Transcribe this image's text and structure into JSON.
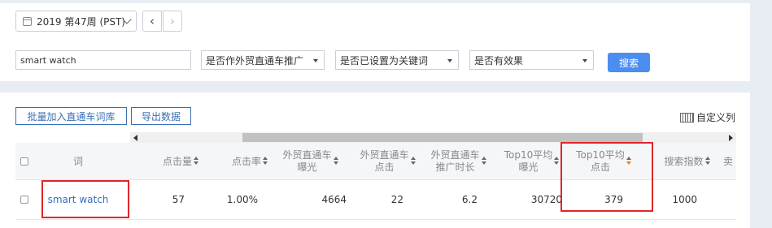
{
  "filters": {
    "week": "2019 第47周 (PST)",
    "prev_symbol": "‹",
    "next_symbol": "›",
    "search_value": "smart watch",
    "promo_select": "是否作外贸直通车推广",
    "keyword_select": "是否已设置为关键词",
    "effect_select": "是否有效果",
    "search_button": "搜索"
  },
  "toolbar": {
    "batch_add": "批量加入直通车词库",
    "export": "导出数据",
    "custom_columns": "自定义列"
  },
  "table": {
    "headers": {
      "word": "词",
      "clicks": "点击量",
      "ctr": "点击率",
      "p4p_impr_1": "外贸直通车",
      "p4p_impr_2": "曝光",
      "p4p_clicks_1": "外贸直通车",
      "p4p_clicks_2": "点击",
      "p4p_dur_1": "外贸直通车",
      "p4p_dur_2": "推广时长",
      "top10_impr_1": "Top10平均",
      "top10_impr_2": "曝光",
      "top10_clicks_1": "Top10平均",
      "top10_clicks_2": "点击",
      "search_index": "搜索指数",
      "seller": "卖"
    },
    "row": {
      "word": "smart watch",
      "clicks": "57",
      "ctr": "1.00%",
      "p4p_impr": "4664",
      "p4p_clicks": "22",
      "p4p_dur": "6.2",
      "top10_impr": "30720",
      "top10_clicks": "379",
      "search_index": "1000"
    }
  },
  "colors": {
    "accent": "#4b8ef0",
    "link": "#2f6fc0",
    "highlight_box": "#e0262a",
    "sort_active": "#e87a20"
  }
}
